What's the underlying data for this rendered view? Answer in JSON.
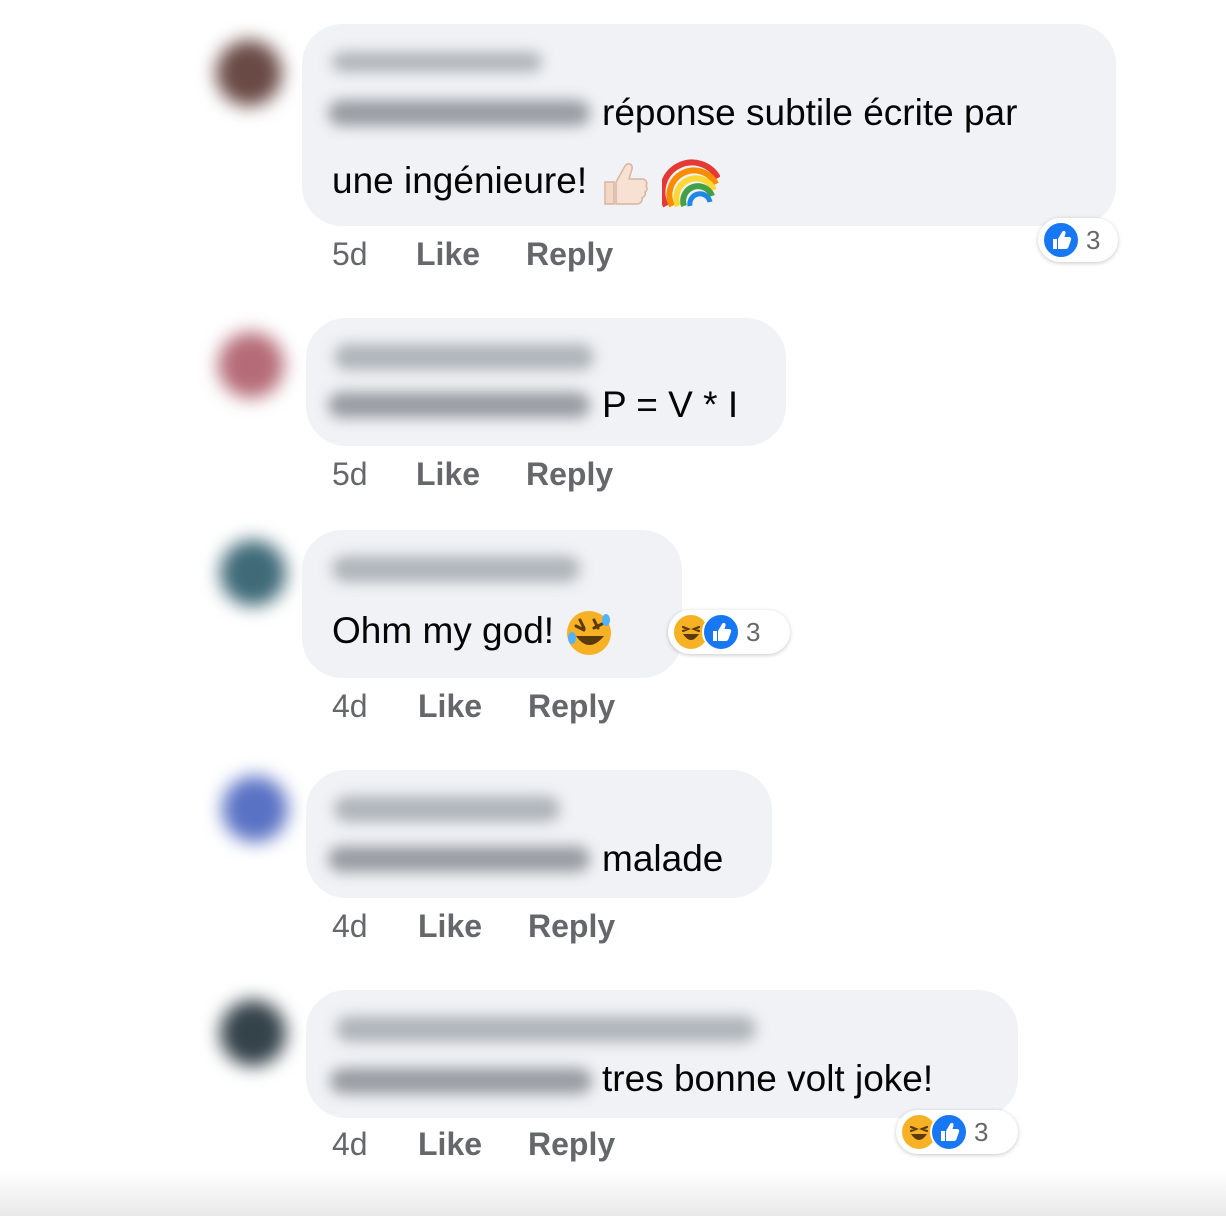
{
  "comments": [
    {
      "text_line1": "réponse subtile écrite par",
      "text_line2": "une ingénieure!",
      "emoji": [
        "thumbs-up-icon",
        "rainbow-icon"
      ],
      "time": "5d",
      "like": "Like",
      "reply": "Reply",
      "reactions": [
        "like"
      ],
      "reaction_count": "3"
    },
    {
      "text": "P = V * I",
      "time": "5d",
      "like": "Like",
      "reply": "Reply"
    },
    {
      "text": "Ohm my god!",
      "emoji": [
        "rolling-laughing-icon"
      ],
      "time": "4d",
      "like": "Like",
      "reply": "Reply",
      "reactions": [
        "haha",
        "like"
      ],
      "reaction_count": "3"
    },
    {
      "text": "malade",
      "time": "4d",
      "like": "Like",
      "reply": "Reply"
    },
    {
      "text": "tres bonne volt joke!",
      "time": "4d",
      "like": "Like",
      "reply": "Reply",
      "reactions": [
        "haha",
        "like"
      ],
      "reaction_count": "3"
    }
  ],
  "colors": {
    "bubble": "#f0f2f5",
    "meta_text": "#65676b",
    "like_blue": "#1877f2",
    "haha_yellow": "#f7b125"
  }
}
